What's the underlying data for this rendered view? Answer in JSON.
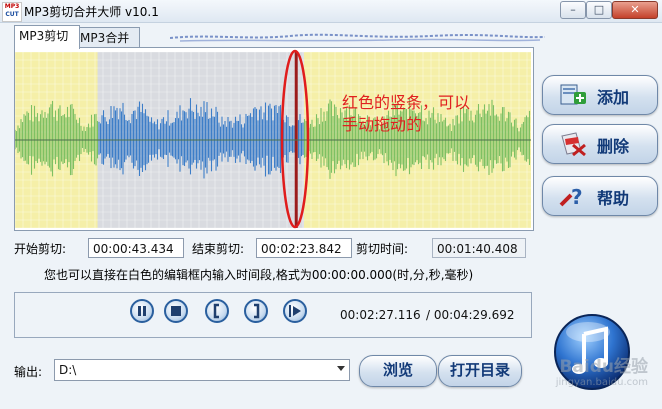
{
  "window": {
    "title": "MP3剪切合并大师 v10.1",
    "icon_text": [
      "MP3",
      "CUT"
    ],
    "controls": {
      "minimize": "–",
      "maximize": "□",
      "close": "✕"
    }
  },
  "tabs": [
    {
      "label": "MP3剪切",
      "active": true
    },
    {
      "label": "MP3合并",
      "active": false
    }
  ],
  "waveform": {
    "selection_start_fraction": 0.16,
    "selection_end_fraction": 0.56,
    "marker_fraction": 0.545,
    "colors": {
      "unselected_bg": "#f5efa8",
      "selected_bg": "#d9dbe0",
      "wave_unselected": "#7ec063",
      "wave_selected": "#3d7ec8",
      "marker": "#9b1b1b"
    }
  },
  "annotation": {
    "line1": "红色的竖条，可以",
    "line2": "手动拖动的",
    "color": "#e02020"
  },
  "side_buttons": {
    "add": "添加",
    "delete": "删除",
    "help": "帮助"
  },
  "times": {
    "start_label": "开始剪切:",
    "start_value": "00:00:43.434",
    "end_label": "结束剪切:",
    "end_value": "00:02:23.842",
    "duration_label": "剪切时间:",
    "duration_value": "00:01:40.408"
  },
  "hint": "您也可以直接在白色的编辑框内输入时间段,格式为00:00:00.000(时,分,秒,毫秒)",
  "player": {
    "current_time": "00:02:27.116",
    "total_time": "/ 00:04:29.692",
    "buttons": [
      "pause",
      "stop",
      "mark-start",
      "mark-end",
      "play-selection"
    ]
  },
  "output": {
    "label": "输出:",
    "path": "D:\\",
    "browse": "浏览",
    "open_dir": "打开目录"
  },
  "watermark": {
    "brand": "Baidu经验",
    "url": "jingyan.baidu.com"
  }
}
